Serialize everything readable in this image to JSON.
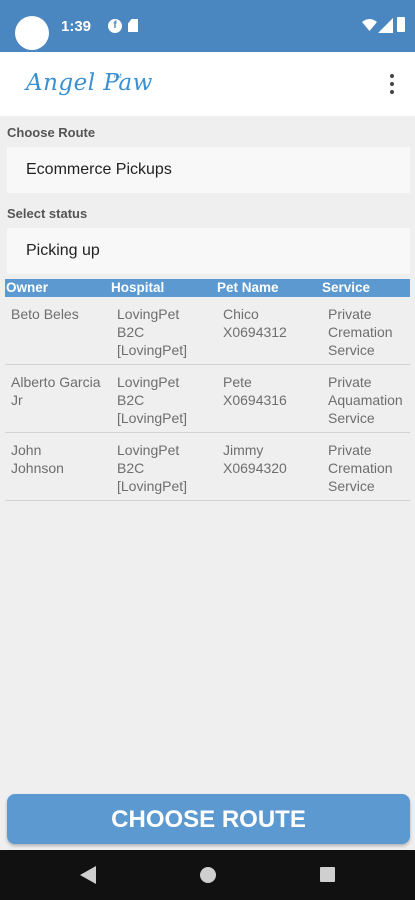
{
  "status_bar": {
    "time": "1:39",
    "icons": [
      "camera-cutout",
      "f-notification-icon",
      "sd-card-icon",
      "wifi-icon",
      "signal-icon",
      "battery-icon"
    ]
  },
  "app_bar": {
    "logo_text": "Angel Paw",
    "logo_tm": "TM",
    "menu_icon": "overflow-menu-icon"
  },
  "form": {
    "route_label": "Choose Route",
    "route_value": "Ecommerce Pickups",
    "status_label": "Select status",
    "status_value": "Picking up"
  },
  "table": {
    "headers": [
      "Owner",
      "Hospital",
      "Pet Name",
      "Service"
    ],
    "rows": [
      {
        "owner": "Beto Beles",
        "hospital": "LovingPet\nB2C\n[LovingPet]",
        "pet": "Chico\nX0694312",
        "service": "Private\nCremation\nService"
      },
      {
        "owner": "Alberto Garcia\nJr",
        "hospital": "LovingPet\nB2C\n[LovingPet]",
        "pet": "Pete\nX0694316",
        "service": "Private\nAquamation\nService"
      },
      {
        "owner": "John\nJohnson",
        "hospital": "LovingPet\nB2C\n[LovingPet]",
        "pet": "Jimmy\nX0694320",
        "service": "Private\nCremation\nService"
      }
    ]
  },
  "button": {
    "label": "CHOOSE ROUTE"
  },
  "nav_bar": {
    "icons": [
      "back-icon",
      "home-icon",
      "recents-icon"
    ]
  },
  "colors": {
    "primary": "#4a86c0",
    "accent": "#5b99d0",
    "logo": "#3a8fd0"
  }
}
